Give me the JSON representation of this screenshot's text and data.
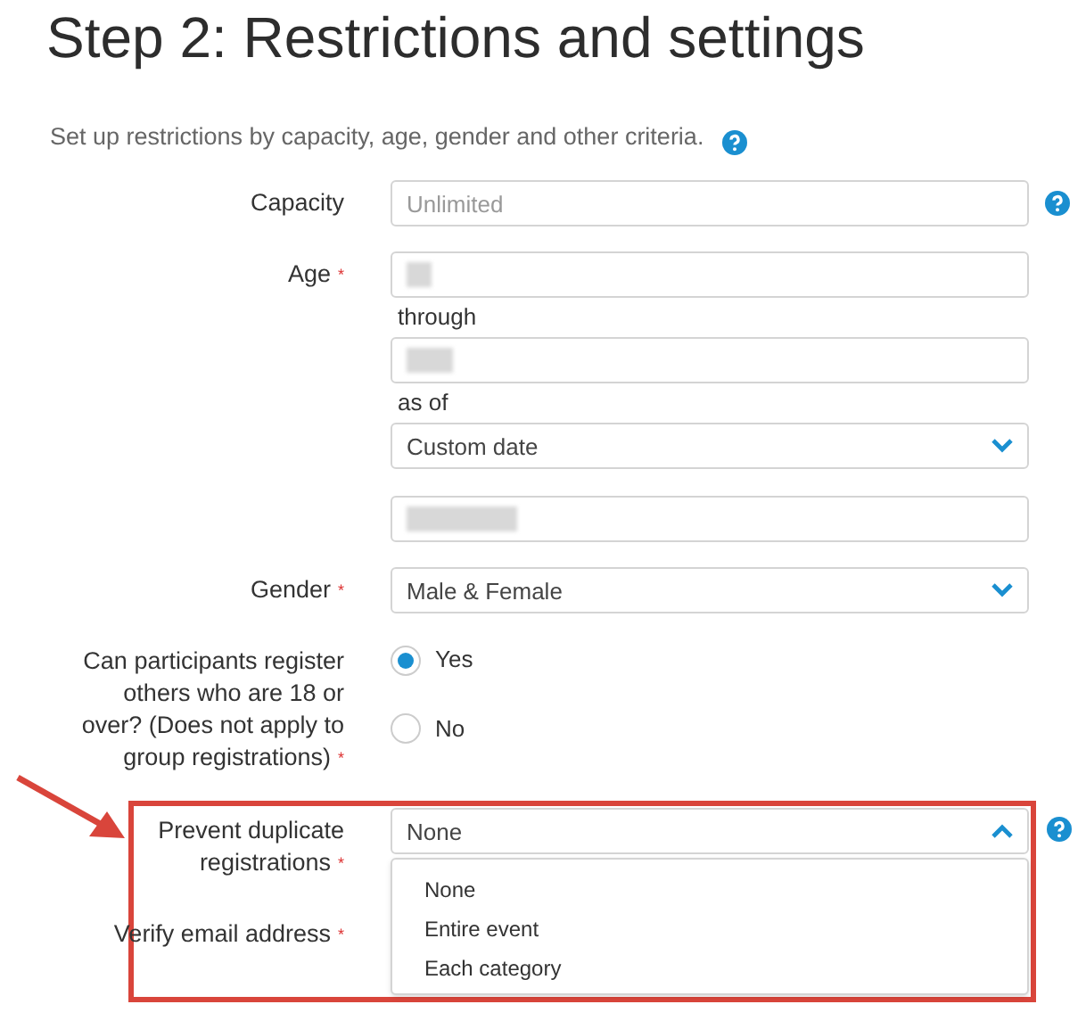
{
  "title": "Step 2: Restrictions and settings",
  "intro": {
    "text": "Set up restrictions by capacity, age, gender and other criteria."
  },
  "fields": [
    {
      "kind": "input",
      "label": "Capacity",
      "placeholder": "Unlimited",
      "help": true
    },
    {
      "kind": "age",
      "label": "Age",
      "required_mark": "*",
      "through": "through",
      "as_of": "as of",
      "as_of_value": "Custom date"
    },
    {
      "kind": "select",
      "label": "Gender",
      "required_mark": "*",
      "value": "Male & Female"
    },
    {
      "kind": "radio",
      "label": "Can participants register others who are 18 or over? (Does not apply to group registrations)",
      "required_mark": "*",
      "options": [
        {
          "label": "Yes",
          "selected": true
        },
        {
          "label": "No",
          "selected": false
        }
      ]
    },
    {
      "kind": "dropdown",
      "label": "Prevent duplicate registrations",
      "required_mark": "*",
      "value": "None",
      "expanded": true,
      "options": [
        "None",
        "Entire event",
        "Each category"
      ],
      "help": true
    },
    {
      "label": "Verify email address",
      "required_mark": "*"
    }
  ]
}
